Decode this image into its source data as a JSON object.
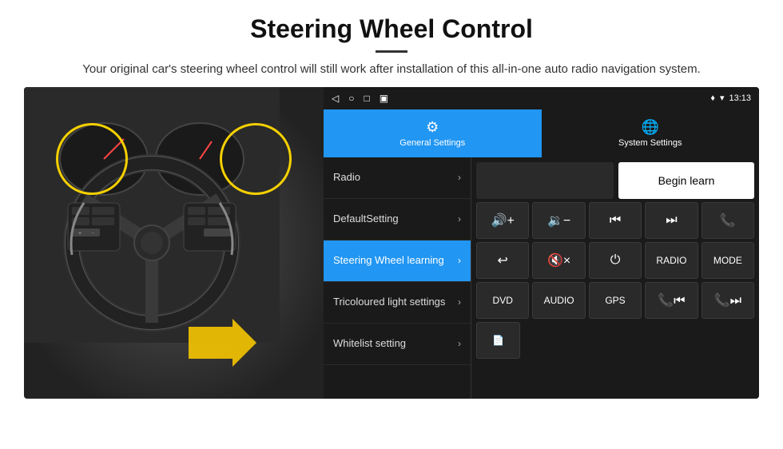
{
  "header": {
    "title": "Steering Wheel Control",
    "subtitle": "Your original car's steering wheel control will still work after installation of this all-in-one auto radio navigation system."
  },
  "statusBar": {
    "time": "13:13",
    "icons": [
      "◁",
      "○",
      "□",
      "▣"
    ]
  },
  "tabs": [
    {
      "id": "general",
      "label": "General Settings",
      "icon": "⚙",
      "active": true
    },
    {
      "id": "system",
      "label": "System Settings",
      "icon": "🌐",
      "active": false
    }
  ],
  "menuItems": [
    {
      "id": "radio",
      "label": "Radio",
      "active": false
    },
    {
      "id": "default",
      "label": "DefaultSetting",
      "active": false
    },
    {
      "id": "steering",
      "label": "Steering Wheel learning",
      "active": true
    },
    {
      "id": "tricoloured",
      "label": "Tricoloured light settings",
      "active": false
    },
    {
      "id": "whitelist",
      "label": "Whitelist setting",
      "active": false
    }
  ],
  "controls": {
    "beginLearnLabel": "Begin learn",
    "row1": [
      {
        "id": "vol-up",
        "label": "🔊+",
        "type": "icon"
      },
      {
        "id": "vol-down",
        "label": "🔉−",
        "type": "icon"
      },
      {
        "id": "prev",
        "label": "⏮",
        "type": "icon"
      },
      {
        "id": "next",
        "label": "⏭",
        "type": "icon"
      },
      {
        "id": "phone",
        "label": "📞",
        "type": "icon"
      }
    ],
    "row2": [
      {
        "id": "hang-up",
        "label": "↩",
        "type": "icon"
      },
      {
        "id": "mute",
        "label": "🔇×",
        "type": "icon"
      },
      {
        "id": "power",
        "label": "⏻",
        "type": "icon"
      },
      {
        "id": "radio-btn",
        "label": "RADIO",
        "type": "text"
      },
      {
        "id": "mode",
        "label": "MODE",
        "type": "text"
      }
    ],
    "row3": [
      {
        "id": "dvd",
        "label": "DVD",
        "type": "text"
      },
      {
        "id": "audio",
        "label": "AUDIO",
        "type": "text"
      },
      {
        "id": "gps",
        "label": "GPS",
        "type": "text"
      },
      {
        "id": "phone-prev",
        "label": "📞⏮",
        "type": "icon"
      },
      {
        "id": "phone-next",
        "label": "📞⏭",
        "type": "icon"
      }
    ],
    "row4": [
      {
        "id": "doc",
        "label": "📄",
        "type": "icon"
      }
    ]
  }
}
